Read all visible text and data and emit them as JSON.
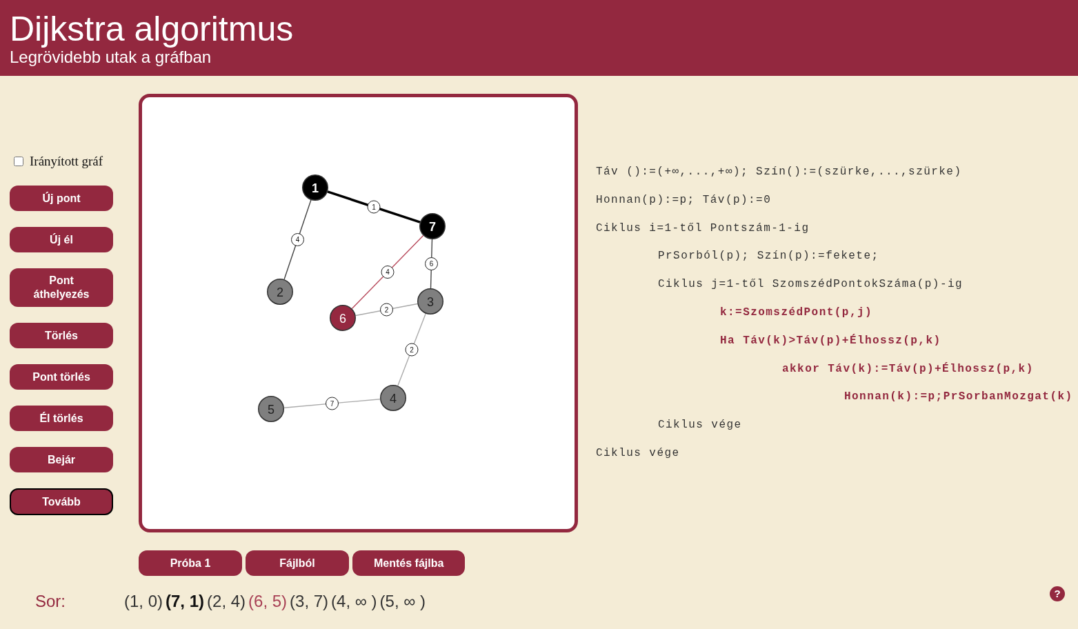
{
  "header": {
    "title": "Dijkstra algoritmus",
    "subtitle": "Legrövidebb utak a gráfban"
  },
  "sidebar": {
    "directed": {
      "label": "Irányított gráf",
      "checked": false
    },
    "buttons": [
      {
        "label": "Új pont",
        "focused": false
      },
      {
        "label": "Új él",
        "focused": false
      },
      {
        "label": "Pont áthelyezés",
        "focused": false
      },
      {
        "label": "Törlés",
        "focused": false
      },
      {
        "label": "Pont törlés",
        "focused": false
      },
      {
        "label": "Él törlés",
        "focused": false
      },
      {
        "label": "Bejár",
        "focused": false
      },
      {
        "label": "Tovább",
        "focused": true
      }
    ]
  },
  "graph": {
    "nodes": [
      {
        "label": "1",
        "color": "#000000",
        "visited": true
      },
      {
        "label": "7",
        "color": "#000000",
        "visited": true
      },
      {
        "label": "2",
        "color": "#7f7f7f",
        "visited": false
      },
      {
        "label": "6",
        "color": "#952840",
        "visited": false
      },
      {
        "label": "3",
        "color": "#7f7f7f",
        "visited": false
      },
      {
        "label": "4",
        "color": "#7f7f7f",
        "visited": false
      },
      {
        "label": "5",
        "color": "#7f7f7f",
        "visited": false
      }
    ],
    "edges": [
      {
        "weight": "1",
        "color": "#000000",
        "tree": true
      },
      {
        "weight": "4",
        "color": "#444444",
        "tree": false
      },
      {
        "weight": "4",
        "color": "#b84a5c",
        "tree": false
      },
      {
        "weight": "6",
        "color": "#444444",
        "tree": false
      },
      {
        "weight": "2",
        "color": "#aaaaaa",
        "tree": false
      },
      {
        "weight": "2",
        "color": "#aaaaaa",
        "tree": false
      },
      {
        "weight": "7",
        "color": "#aaaaaa",
        "tree": false
      }
    ]
  },
  "file_buttons": [
    {
      "label": "Próba 1"
    },
    {
      "label": "Fájlból"
    },
    {
      "label": "Mentés fájlba"
    }
  ],
  "code": [
    {
      "text": "Táv ():=(+∞,...,+∞); Szín():=(szürke,...,szürke)",
      "highlighted": false
    },
    {
      "text": "Honnan(p):=p; Táv(p):=0",
      "highlighted": false
    },
    {
      "text": "Ciklus i=1-től Pontszám-1-ig",
      "highlighted": false,
      "children": [
        {
          "text": "PrSorból(p); Szín(p):=fekete;",
          "highlighted": false
        },
        {
          "text": "Ciklus j=1-től SzomszédPontokSzáma(p)-ig",
          "highlighted": false,
          "children": [
            {
              "text": "k:=SzomszédPont(p,j)",
              "highlighted": true
            },
            {
              "text": "Ha Táv(k)>Táv(p)+Élhossz(p,k)",
              "highlighted": true,
              "children": [
                {
                  "text": "akkor Táv(k):=Táv(p)+Élhossz(p,k)",
                  "highlighted": true,
                  "children": [
                    {
                      "text": "Honnan(k):=p;PrSorbanMozgat(k)",
                      "highlighted": true
                    }
                  ]
                }
              ]
            }
          ]
        },
        {
          "text": "Ciklus vége",
          "highlighted": false
        }
      ]
    },
    {
      "text": "Ciklus vége",
      "highlighted": false
    }
  ],
  "queue": {
    "label": "Sor:",
    "items": [
      {
        "text": "(1, 0)",
        "bold": false,
        "color": "#333333"
      },
      {
        "text": "(7, 1)",
        "bold": true,
        "color": "#111111"
      },
      {
        "text": "(2, 4)",
        "bold": false,
        "color": "#333333"
      },
      {
        "text": "(6, 5)",
        "bold": false,
        "color": "#a84055"
      },
      {
        "text": "(3, 7)",
        "bold": false,
        "color": "#333333"
      },
      {
        "text": "(4, ∞ )",
        "bold": false,
        "color": "#333333"
      },
      {
        "text": "(5, ∞ )",
        "bold": false,
        "color": "#333333"
      }
    ]
  },
  "help": {
    "label": "?"
  }
}
